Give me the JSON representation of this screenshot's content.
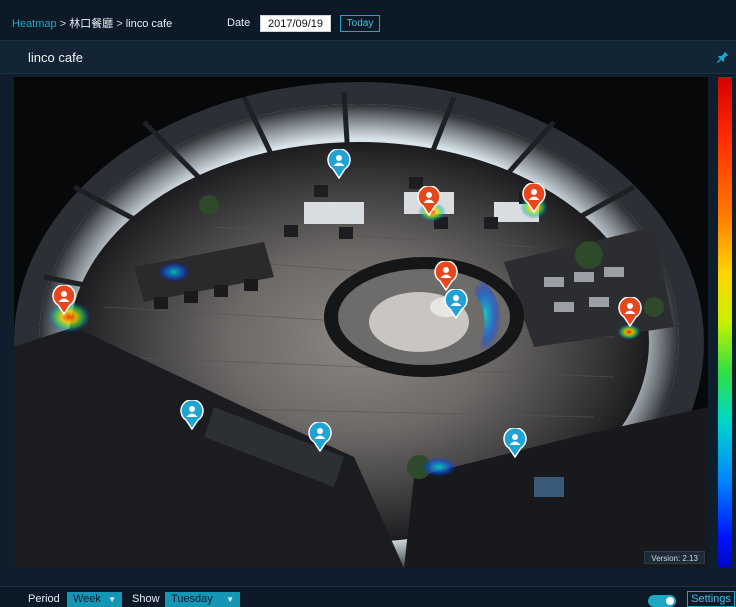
{
  "breadcrumb": {
    "root": "Heatmap",
    "separator": " > ",
    "level1": "林口餐廳",
    "level2": "linco cafe"
  },
  "date": {
    "label": "Date",
    "value": "2017/09/19",
    "today_label": "Today"
  },
  "panel": {
    "title": "linco cafe",
    "pin_icon": "pin-icon"
  },
  "view": {
    "version_label": "Version: 2.13"
  },
  "legend": {
    "top_color": "#d50000",
    "bottom_color": "#0008c0"
  },
  "markers": {
    "red_color": "#e8461d",
    "blue_color": "#1fa3d4",
    "icon": "person-icon"
  },
  "bottom": {
    "period_label": "Period",
    "period_value": "Week",
    "show_label": "Show",
    "show_value": "Tuesday",
    "toggle_on": true,
    "settings_label": "Settings"
  }
}
